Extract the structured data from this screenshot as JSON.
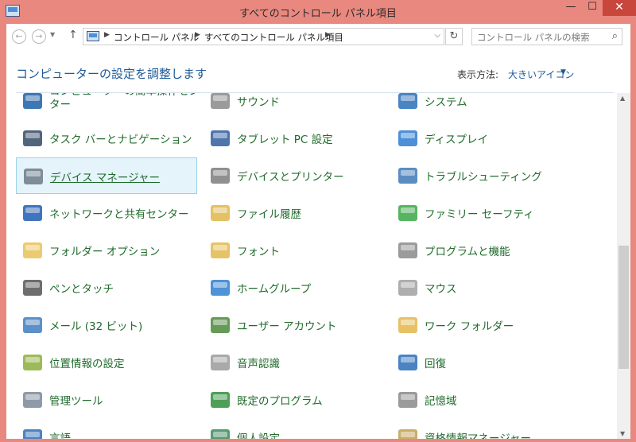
{
  "window": {
    "title": "すべてのコントロール パネル項目",
    "minimize": "—",
    "maximize": "☐",
    "close": "✕"
  },
  "nav": {
    "back": "←",
    "forward": "→",
    "recent": "▼",
    "up": "↑",
    "crumb_sep": "▶",
    "breadcrumbs": [
      "コントロール パネル",
      "すべてのコントロール パネル項目"
    ],
    "address_dropdown": "⌵",
    "refresh": "↻",
    "search_placeholder": "コントロール パネルの検索",
    "search_icon": "⌕"
  },
  "header": {
    "title": "コンピューターの設定を調整します",
    "view_label": "表示方法:",
    "view_value": "大きいアイコン",
    "view_caret": "▼"
  },
  "items": [
    {
      "label": "コンピューターの簡単操作センター",
      "label_lines": [
        "コンピューターの簡単操作セン",
        "ター"
      ],
      "icon": "ease-of-access-icon",
      "color": "#1c5fa8"
    },
    {
      "label": "サウンド",
      "icon": "speaker-icon",
      "color": "#8a8a8a"
    },
    {
      "label": "システム",
      "icon": "computer-icon",
      "color": "#2a6fb8"
    },
    {
      "label": "タスク バーとナビゲーション",
      "icon": "taskbar-icon",
      "color": "#334a66"
    },
    {
      "label": "タブレット PC 設定",
      "icon": "tablet-icon",
      "color": "#2f5e9e"
    },
    {
      "label": "ディスプレイ",
      "icon": "monitor-icon",
      "color": "#2e7cd0"
    },
    {
      "label": "デバイス マネージャー",
      "icon": "device-manager-icon",
      "color": "#6c7a88",
      "selected": true
    },
    {
      "label": "デバイスとプリンター",
      "icon": "printer-icon",
      "color": "#7c7c7c"
    },
    {
      "label": "トラブルシューティング",
      "icon": "troubleshoot-icon",
      "color": "#3f79b7"
    },
    {
      "label": "ネットワークと共有センター",
      "icon": "network-icon",
      "color": "#1f5cb3"
    },
    {
      "label": "ファイル履歴",
      "icon": "file-history-icon",
      "color": "#e0b64a"
    },
    {
      "label": "ファミリー セーフティ",
      "icon": "family-safety-icon",
      "color": "#3aa845"
    },
    {
      "label": "フォルダー オプション",
      "icon": "folder-options-icon",
      "color": "#e9c156"
    },
    {
      "label": "フォント",
      "icon": "font-folder-icon",
      "color": "#e2b94c"
    },
    {
      "label": "プログラムと機能",
      "icon": "programs-icon",
      "color": "#8a8a8a"
    },
    {
      "label": "ペンとタッチ",
      "icon": "pen-icon",
      "color": "#555555"
    },
    {
      "label": "ホームグループ",
      "icon": "homegroup-icon",
      "color": "#2f7fd0"
    },
    {
      "label": "マウス",
      "icon": "mouse-icon",
      "color": "#a0a0a0"
    },
    {
      "label": "メール (32 ビット)",
      "icon": "mail-icon",
      "color": "#3e7cc0"
    },
    {
      "label": "ユーザー アカウント",
      "icon": "user-accounts-icon",
      "color": "#4a8a3a"
    },
    {
      "label": "ワーク フォルダー",
      "icon": "work-folder-icon",
      "color": "#e4b64c"
    },
    {
      "label": "位置情報の設定",
      "icon": "location-icon",
      "color": "#8cae3e"
    },
    {
      "label": "音声認識",
      "icon": "microphone-icon",
      "color": "#9a9a9a"
    },
    {
      "label": "回復",
      "icon": "recovery-icon",
      "color": "#2d6db8"
    },
    {
      "label": "管理ツール",
      "icon": "admin-tools-icon",
      "color": "#7a8898"
    },
    {
      "label": "既定のプログラム",
      "icon": "default-programs-icon",
      "color": "#2f8f3a"
    },
    {
      "label": "記憶域",
      "icon": "storage-spaces-icon",
      "color": "#8a8a8a"
    },
    {
      "label": "言語",
      "icon": "language-icon",
      "color": "#2d6db8"
    },
    {
      "label": "個人設定",
      "icon": "personalization-icon",
      "color": "#3a8a5a"
    },
    {
      "label": "資格情報マネージャー",
      "icon": "credential-manager-icon",
      "color": "#c0a050"
    }
  ],
  "scroll": {
    "up": "▲",
    "down": "▼"
  }
}
